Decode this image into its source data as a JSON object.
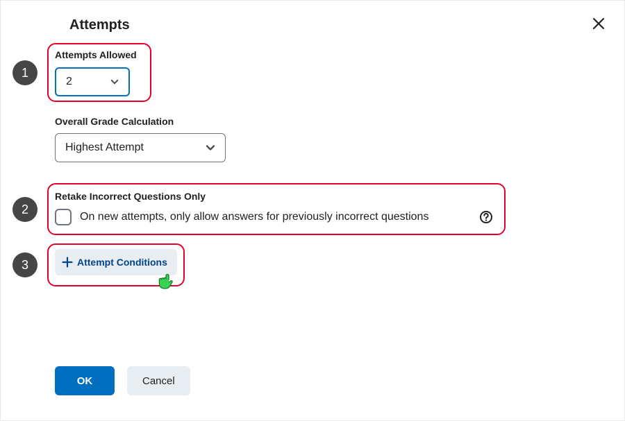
{
  "dialog": {
    "title": "Attempts"
  },
  "attempts_allowed": {
    "label": "Attempts Allowed",
    "value": "2"
  },
  "grade_calc": {
    "label": "Overall Grade Calculation",
    "value": "Highest Attempt"
  },
  "retake": {
    "label": "Retake Incorrect Questions Only",
    "checkbox_label": "On new attempts, only allow answers for previously incorrect questions"
  },
  "attempt_conditions": {
    "button_label": "Attempt Conditions"
  },
  "actions": {
    "ok": "OK",
    "cancel": "Cancel"
  },
  "annotations": {
    "b1": "1",
    "b2": "2",
    "b3": "3"
  }
}
